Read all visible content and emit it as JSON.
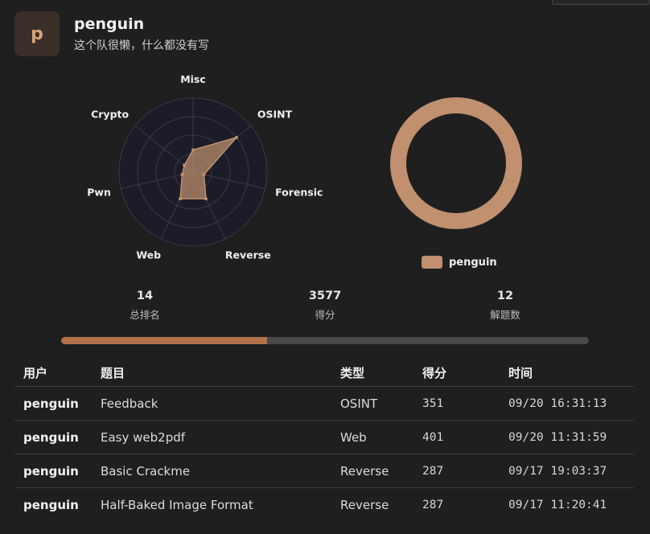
{
  "team": {
    "avatar_letter": "p",
    "name": "penguin",
    "bio": "这个队很懒，什么都没有写"
  },
  "radar": {
    "axes": [
      "Misc",
      "OSINT",
      "Forensic",
      "Reverse",
      "Web",
      "Pwn",
      "Crypto"
    ],
    "values": [
      0.3,
      0.75,
      0.15,
      0.4,
      0.4,
      0.15,
      0.15
    ],
    "color": "#c0906f"
  },
  "ring": {
    "series": [
      {
        "name": "penguin",
        "value": 100
      }
    ],
    "color": "#c0906f"
  },
  "legend": {
    "label": "penguin",
    "color": "#c0906f"
  },
  "stats": [
    {
      "value": "14",
      "label": "总排名"
    },
    {
      "value": "3577",
      "label": "得分"
    },
    {
      "value": "12",
      "label": "解题数"
    }
  ],
  "progress": {
    "fraction": 0.39,
    "fill_color": "#b0714b",
    "track_color": "#4a4a4a"
  },
  "table": {
    "headers": {
      "user": "用户",
      "challenge": "题目",
      "type": "类型",
      "score": "得分",
      "time": "时间"
    },
    "rows": [
      {
        "user": "penguin",
        "challenge": "Feedback",
        "type": "OSINT",
        "score": "351",
        "time": "09/20 16:31:13"
      },
      {
        "user": "penguin",
        "challenge": "Easy web2pdf",
        "type": "Web",
        "score": "401",
        "time": "09/20 11:31:59"
      },
      {
        "user": "penguin",
        "challenge": "Basic Crackme",
        "type": "Reverse",
        "score": "287",
        "time": "09/17 19:03:37"
      },
      {
        "user": "penguin",
        "challenge": "Half-Baked Image Format",
        "type": "Reverse",
        "score": "287",
        "time": "09/17 11:20:41"
      }
    ]
  }
}
